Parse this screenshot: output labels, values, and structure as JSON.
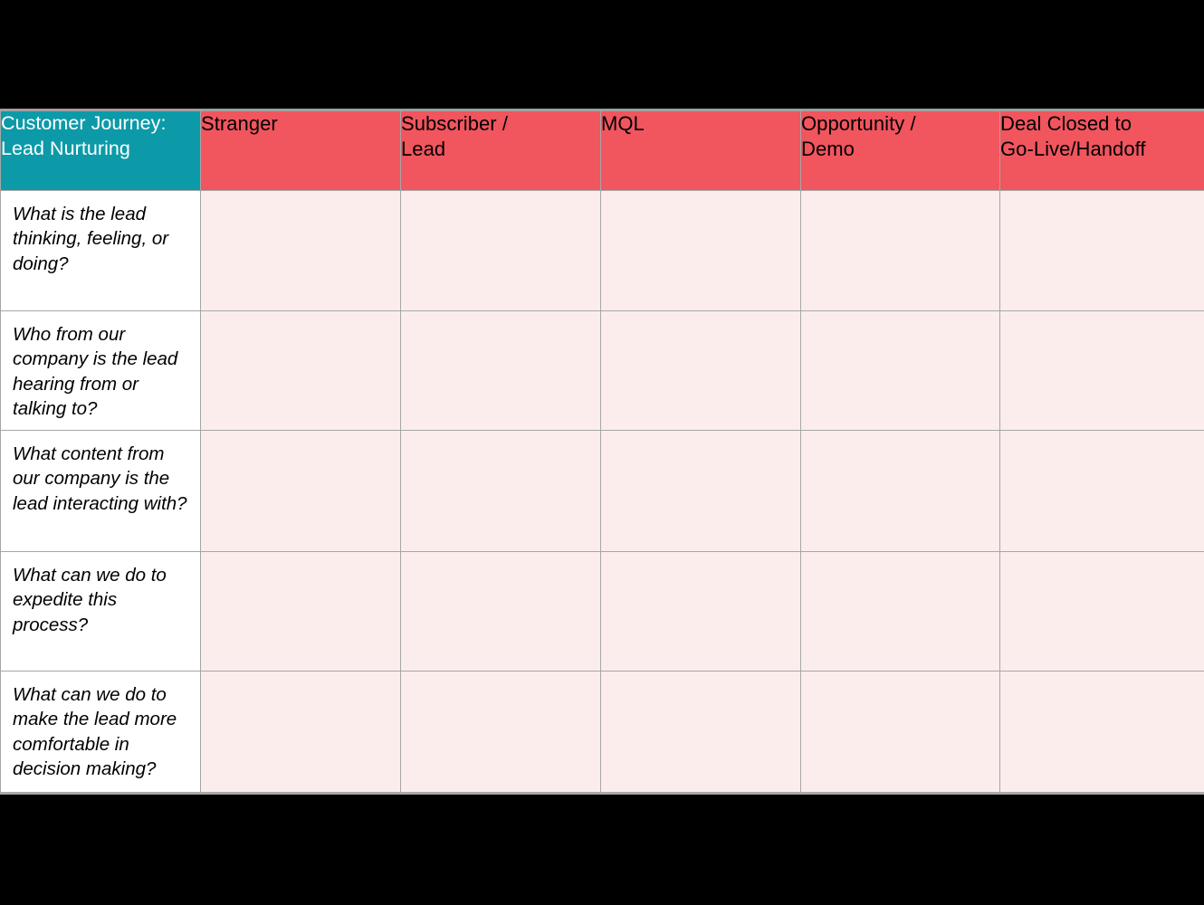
{
  "slide": {
    "background_color": "#000000",
    "surface_color": "#ffffff",
    "accent_teal": "#0d9aa8",
    "accent_red": "#f1555e",
    "cell_fill": "#fceded",
    "grid_line_color": "#a6a6a6"
  },
  "table": {
    "title_cell": {
      "line1": "Customer Journey:",
      "line2": "Lead Nurturing",
      "full": "Customer Journey: Lead Nurturing"
    },
    "stage_headers": [
      {
        "line1": "Stranger",
        "line2": "",
        "full": "Stranger"
      },
      {
        "line1": "Subscriber /",
        "line2": "Lead",
        "full": "Subscriber / Lead"
      },
      {
        "line1": "MQL",
        "line2": "",
        "full": "MQL"
      },
      {
        "line1": "Opportunity /",
        "line2": "Demo",
        "full": "Opportunity / Demo"
      },
      {
        "line1": "Deal Closed to",
        "line2": "Go-Live/Handoff",
        "full": "Deal Closed to Go-Live/Handoff"
      }
    ],
    "rows": [
      {
        "question": "What is the lead thinking, feeling, or doing?",
        "cells": [
          "",
          "",
          "",
          "",
          ""
        ]
      },
      {
        "question": "Who from our company is the lead hearing from or talking to?",
        "cells": [
          "",
          "",
          "",
          "",
          ""
        ]
      },
      {
        "question": "What content from our company is the lead interacting with?",
        "cells": [
          "",
          "",
          "",
          "",
          ""
        ]
      },
      {
        "question": "What can we do to expedite this process?",
        "cells": [
          "",
          "",
          "",
          "",
          ""
        ]
      },
      {
        "question": "What can we do to make the lead more comfortable in decision making?",
        "cells": [
          "",
          "",
          "",
          "",
          ""
        ]
      }
    ]
  }
}
